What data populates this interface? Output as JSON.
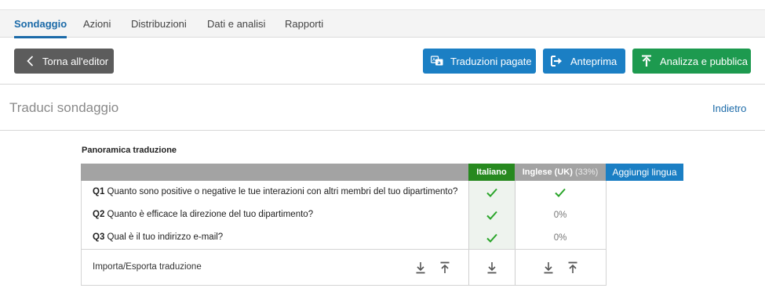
{
  "nav": {
    "tabs": [
      {
        "label": "Sondaggio",
        "active": true
      },
      {
        "label": "Azioni"
      },
      {
        "label": "Distribuzioni"
      },
      {
        "label": "Dati e analisi"
      },
      {
        "label": "Rapporti"
      }
    ]
  },
  "toolbar": {
    "back_label": "Torna all'editor",
    "paid_translations_label": "Traduzioni pagate",
    "preview_label": "Anteprima",
    "publish_label": "Analizza e pubblica"
  },
  "page": {
    "title": "Traduci sondaggio",
    "back_link": "Indietro"
  },
  "overview": {
    "title": "Panoramica traduzione",
    "languages": [
      {
        "name": "Italiano"
      },
      {
        "name": "Inglese (UK)",
        "progress": "(33%)"
      }
    ],
    "add_language_label": "Aggiungi lingua",
    "questions": [
      {
        "id": "Q1",
        "text": "Quanto sono positive o negative le tue interazioni con altri membri del tuo dipartimento?",
        "italiano": "check",
        "inglese": "check"
      },
      {
        "id": "Q2",
        "text": "Quanto è efficace la direzione del tuo dipartimento?",
        "italiano": "check",
        "inglese": "0%"
      },
      {
        "id": "Q3",
        "text": "Qual è il tuo indirizzo e-mail?",
        "italiano": "check",
        "inglese": "0%"
      }
    ],
    "import_export_label": "Importa/Esporta traduzione"
  },
  "colors": {
    "accent_blue": "#1b7fc4",
    "active_tab": "#1b6aa8",
    "publish_green": "#1d9a4f",
    "italian_header": "#27891f",
    "check_green": "#2aa52a",
    "header_gray": "#a3a3a3"
  }
}
